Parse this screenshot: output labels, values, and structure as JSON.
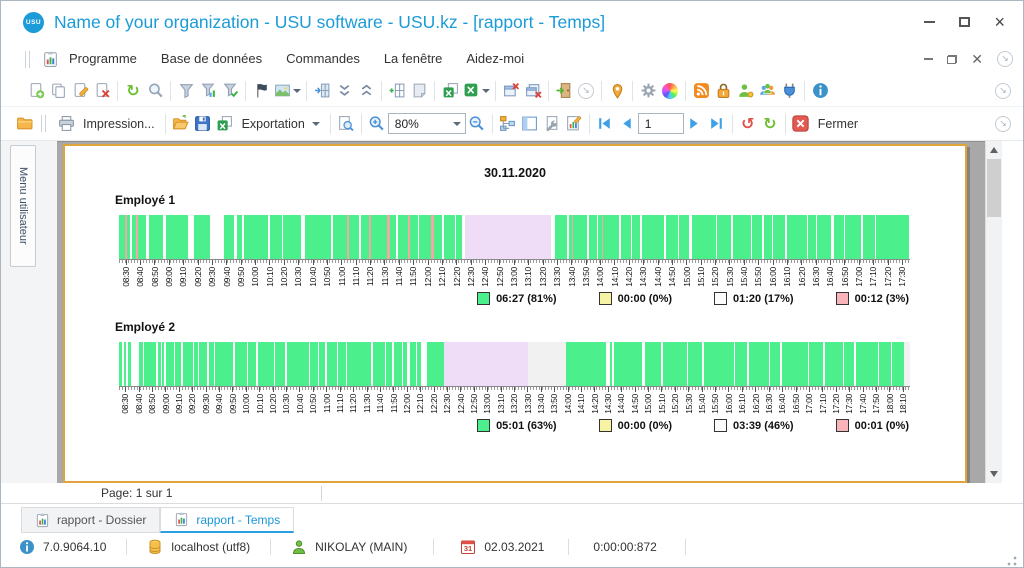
{
  "window": {
    "title": "Name of your organization - USU software - USU.kz - [rapport - Temps]",
    "logo_text": "USU"
  },
  "menubar": {
    "items": [
      "Programme",
      "Base de données",
      "Commandes",
      "La fenêtre",
      "Aidez-moi"
    ]
  },
  "toolbar": {
    "impression_label": "Impression...",
    "exportation_label": "Exportation",
    "zoom_value": "80%",
    "page_value": "1",
    "fermer_label": "Fermer"
  },
  "sidebar": {
    "label": "Menu utilisateur"
  },
  "report": {
    "date_title": "30.11.2020",
    "page_status": "Page: 1 sur 1",
    "colors": {
      "g": "#4BF08C",
      "w": "#FFFFFF",
      "p": "#F2A8A4",
      "l": "#EFDCF7",
      "e": "transparent"
    },
    "employees": [
      {
        "name": "Employé 1",
        "row_bg": "#FFFFFF",
        "segments": "g6 p2 g3 w2 g4 p2 g8 w3 g14 w3 g22 w6 g16 w14 g10 w3 g5 w2 g24 w2 g12 w1 g18 w4 g26 w2 g14 p2 g10 w2 g8 p2 g16 p3 g6 w2 g10 p2 g8 w1 g12 p3 g8 w2 g10 w1 g6 w3 l86 w4 g12 w2 g3 p1 g14 w2 g8 w1 g4 p1 g16 w2 g10 w1 g8 w2 g22 w2 g12 w1 g10 w3 g24 w1 g14 w2 g18 w1 g10 w2 g8 w1 g12 w2 g20 w1 g8 w1 g14 w3 g10 w1 g16 w2 g12 w1 g33",
        "axis_labels": [
          "08:30",
          "08:40",
          "08:50",
          "09:00",
          "09:10",
          "09:20",
          "09:30",
          "09:40",
          "09:50",
          "10:00",
          "10:10",
          "10:20",
          "10:30",
          "10:40",
          "10:50",
          "11:00",
          "11:10",
          "11:20",
          "11:30",
          "11:40",
          "11:50",
          "12:00",
          "12:10",
          "12:20",
          "12:30",
          "12:40",
          "12:50",
          "13:00",
          "13:10",
          "13:20",
          "13:30",
          "13:40",
          "13:50",
          "14:00",
          "14:10",
          "14:20",
          "14:30",
          "14:40",
          "14:50",
          "15:00",
          "15:10",
          "15:20",
          "15:30",
          "15:40",
          "15:50",
          "16:00",
          "16:10",
          "16:20",
          "16:30",
          "16:40",
          "16:50",
          "17:00",
          "17:10",
          "17:20",
          "17:30"
        ],
        "legend": [
          {
            "color": "#4BF08C",
            "label": "06:27 (81%)"
          },
          {
            "color": "#F6F3A4",
            "label": "00:00 (0%)"
          },
          {
            "color": "#FCFCFC",
            "label": "01:20 (17%)"
          },
          {
            "color": "#F8B4B9",
            "label": "00:12 (3%)"
          }
        ]
      },
      {
        "name": "Employé 2",
        "row_bg": "#F1F1F1",
        "segments": "g3 w2 g2 w2 g3 w8 g4 w1 g12 w2 g3 w1 g2 w2 g8 w1 g6 w2 g10 w1 g4 w1 g8 w2 g5 w1 g18 w2 g12 w1 g8 w2 g16 w1 g10 w2 g22 w1 g8 w1 g6 w2 g10 w1 g8 w1 g24 w2 g12 w1 g6 w2 g8 w1 g4 w3 g6 w1 g4 w6 g17 l84 e38 g40 w4 g2 w2 g28 w3 g16 w2 g24 w1 g14 w2 g30 w1 g12 w2 g20 w1 g10 w2 g26 w1 g14 w2 g18 w1 g10 w2 g22 w1 g12 w1 g12 e5",
        "axis_labels": [
          "08:30",
          "08:40",
          "08:50",
          "09:00",
          "09:10",
          "09:20",
          "09:30",
          "09:40",
          "09:50",
          "10:00",
          "10:10",
          "10:20",
          "10:30",
          "10:40",
          "10:50",
          "11:00",
          "11:10",
          "11:20",
          "11:30",
          "11:40",
          "11:50",
          "12:00",
          "12:10",
          "12:20",
          "12:30",
          "12:40",
          "12:50",
          "13:00",
          "13:10",
          "13:20",
          "13:30",
          "13:40",
          "13:50",
          "14:00",
          "14:10",
          "14:20",
          "14:30",
          "14:40",
          "14:50",
          "15:00",
          "15:10",
          "15:20",
          "15:30",
          "15:40",
          "15:50",
          "16:00",
          "16:10",
          "16:20",
          "16:30",
          "16:40",
          "16:50",
          "17:00",
          "17:10",
          "17:20",
          "17:30",
          "17:40",
          "17:50",
          "18:00",
          "18:10"
        ],
        "legend": [
          {
            "color": "#4BF08C",
            "label": "05:01 (63%)"
          },
          {
            "color": "#F6F3A4",
            "label": "00:00 (0%)"
          },
          {
            "color": "#FCFCFC",
            "label": "03:39 (46%)"
          },
          {
            "color": "#F8B4B9",
            "label": "00:01 (0%)"
          }
        ]
      }
    ]
  },
  "tabs": [
    {
      "label": "rapport - Dossier",
      "active": false
    },
    {
      "label": "rapport - Temps",
      "active": true
    }
  ],
  "statusbar": {
    "version": "7.0.9064.10",
    "database": "localhost (utf8)",
    "user": "NIKOLAY (MAIN)",
    "calendar_day": "31",
    "date": "02.03.2021",
    "timer": "0:00:00:872"
  }
}
